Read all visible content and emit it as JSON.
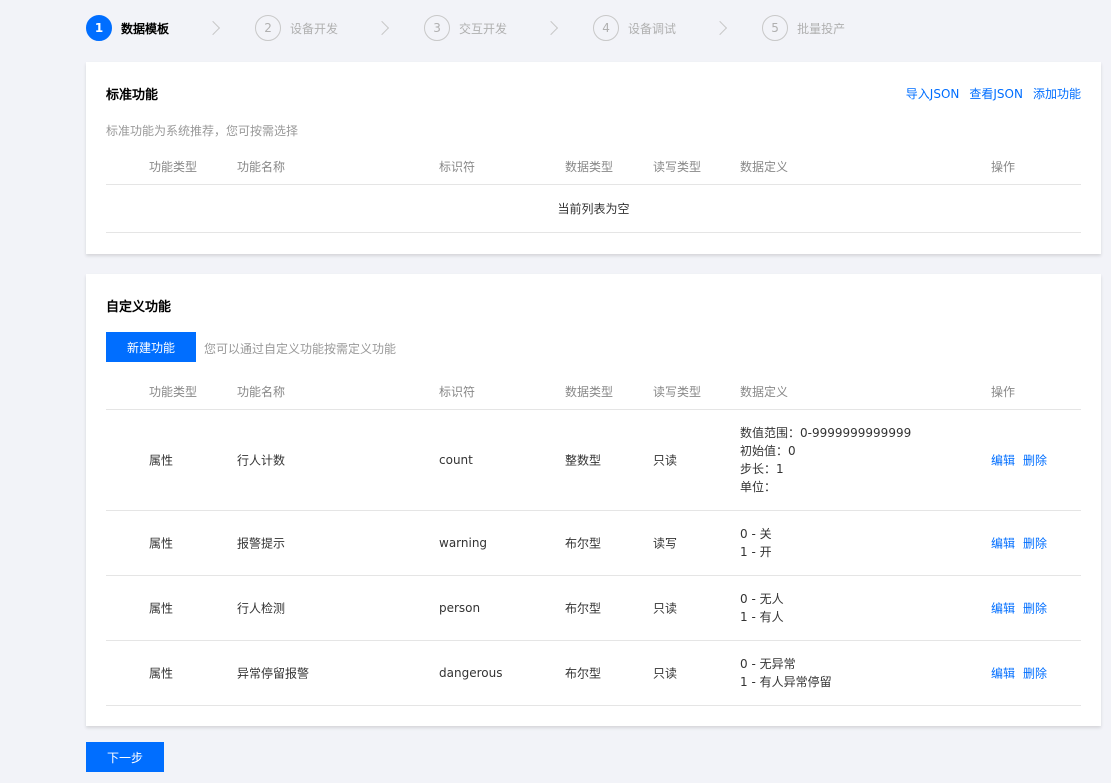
{
  "stepper": {
    "steps": [
      {
        "num": "1",
        "label": "数据模板"
      },
      {
        "num": "2",
        "label": "设备开发"
      },
      {
        "num": "3",
        "label": "交互开发"
      },
      {
        "num": "4",
        "label": "设备调试"
      },
      {
        "num": "5",
        "label": "批量投产"
      }
    ],
    "active_index": 0
  },
  "standard": {
    "title": "标准功能",
    "actions": {
      "import": "导入JSON",
      "view": "查看JSON",
      "add": "添加功能"
    },
    "desc": "标准功能为系统推荐，您可按需选择",
    "empty_text": "当前列表为空"
  },
  "columns": {
    "type": "功能类型",
    "name": "功能名称",
    "id": "标识符",
    "dtype": "数据类型",
    "rw": "读写类型",
    "def": "数据定义",
    "op": "操作"
  },
  "custom": {
    "title": "自定义功能",
    "new_button": "新建功能",
    "hint": "您可以通过自定义功能按需定义功能",
    "edit_label": "编辑",
    "delete_label": "删除",
    "rows": [
      {
        "type": "属性",
        "name": "行人计数",
        "id": "count",
        "dtype": "整数型",
        "rw": "只读",
        "def": [
          "数值范围：0-9999999999999",
          "初始值：0",
          "步长：1",
          "单位："
        ]
      },
      {
        "type": "属性",
        "name": "报警提示",
        "id": "warning",
        "dtype": "布尔型",
        "rw": "读写",
        "def": [
          "0 - 关",
          "1 - 开"
        ]
      },
      {
        "type": "属性",
        "name": "行人检测",
        "id": "person",
        "dtype": "布尔型",
        "rw": "只读",
        "def": [
          "0 - 无人",
          "1 - 有人"
        ]
      },
      {
        "type": "属性",
        "name": "异常停留报警",
        "id": "dangerous",
        "dtype": "布尔型",
        "rw": "只读",
        "def": [
          "0 - 无异常",
          "1 - 有人异常停留"
        ]
      }
    ]
  },
  "footer": {
    "next_button": "下一步"
  },
  "colors": {
    "accent": "#006eff",
    "background": "#f2f3f8"
  }
}
